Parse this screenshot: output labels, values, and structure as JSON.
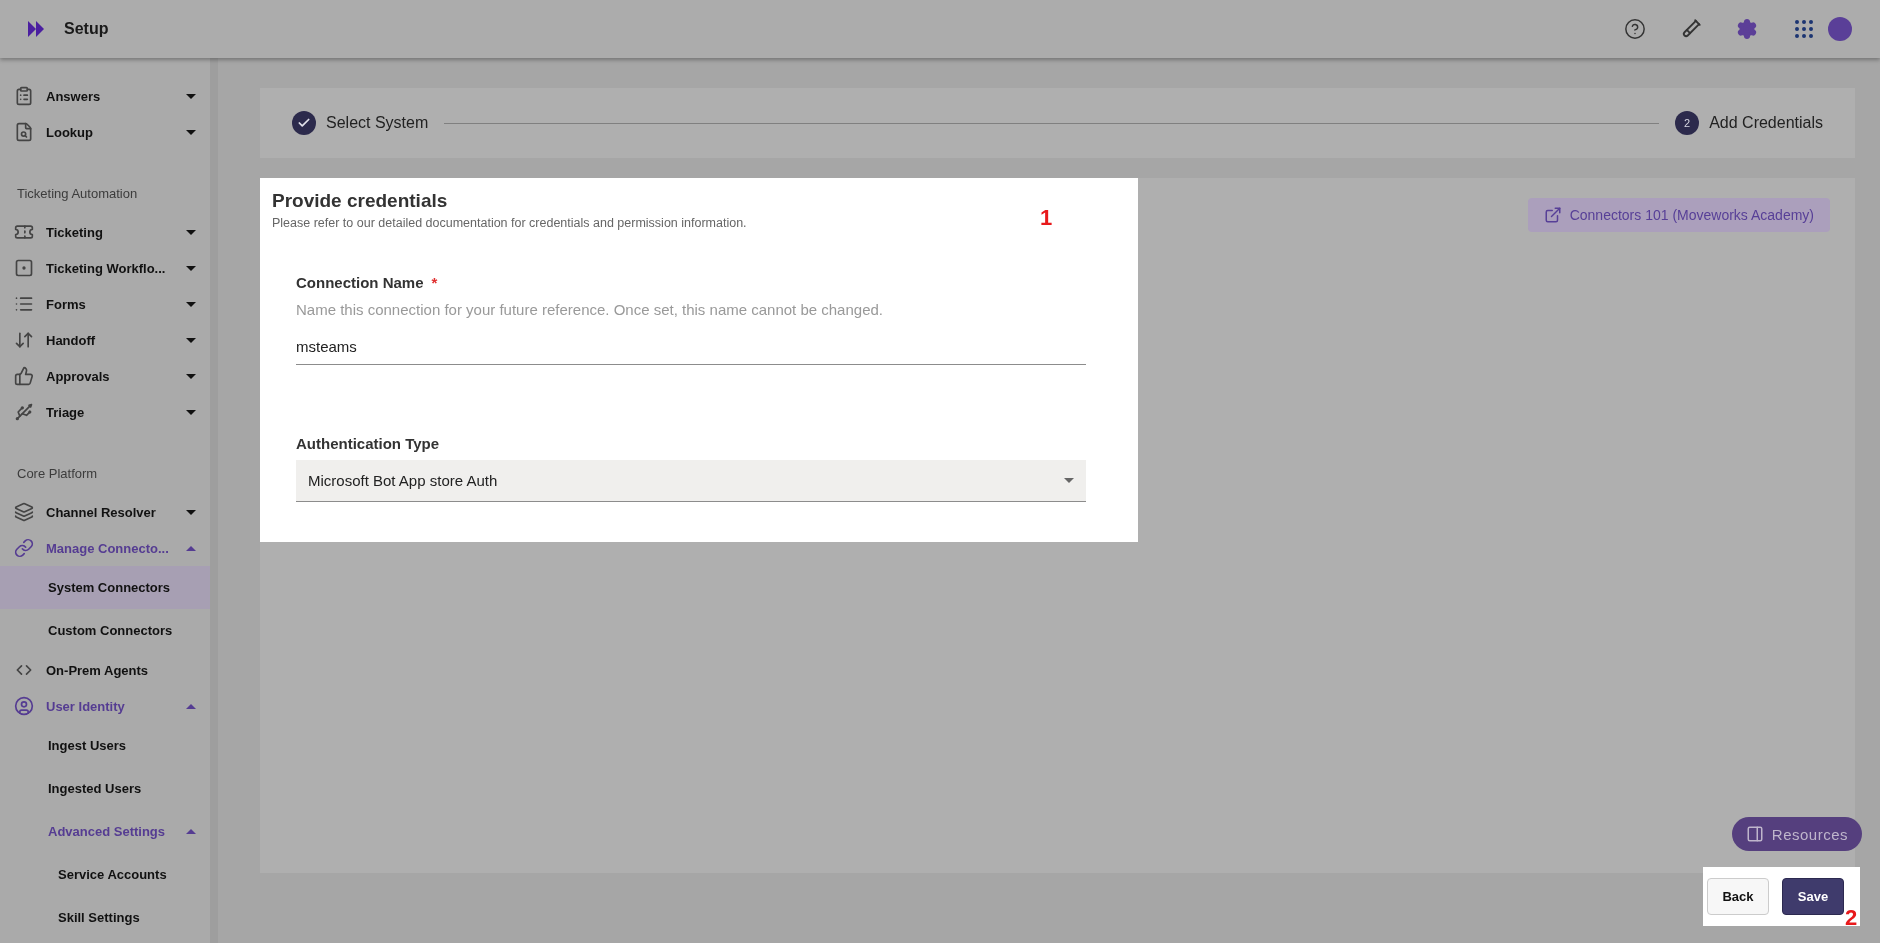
{
  "topbar": {
    "title": "Setup"
  },
  "sidebar": {
    "groups": [
      {
        "items": [
          {
            "kind": "menu",
            "label": "Answers",
            "expanded": false
          },
          {
            "kind": "menu",
            "label": "Lookup",
            "expanded": false
          }
        ]
      },
      {
        "heading": "Ticketing Automation",
        "items": [
          {
            "kind": "menu",
            "label": "Ticketing",
            "expanded": false
          },
          {
            "kind": "menu",
            "label": "Ticketing Workflo...",
            "expanded": false
          },
          {
            "kind": "menu",
            "label": "Forms",
            "expanded": false
          },
          {
            "kind": "menu",
            "label": "Handoff",
            "expanded": false
          },
          {
            "kind": "menu",
            "label": "Approvals",
            "expanded": false
          },
          {
            "kind": "menu",
            "label": "Triage",
            "expanded": false
          }
        ]
      },
      {
        "heading": "Core Platform",
        "items": [
          {
            "kind": "menu",
            "label": "Channel Resolver",
            "expanded": false
          },
          {
            "kind": "menu",
            "label": "Manage Connecto...",
            "expanded": true,
            "children": [
              {
                "label": "System Connectors",
                "selected": true
              },
              {
                "label": "Custom Connectors",
                "selected": false
              }
            ]
          },
          {
            "kind": "link",
            "label": "On-Prem Agents"
          },
          {
            "kind": "menu",
            "label": "User Identity",
            "expanded": true,
            "children": [
              {
                "label": "Ingest Users",
                "selected": false
              },
              {
                "label": "Ingested Users",
                "selected": false
              },
              {
                "label": "Advanced Settings",
                "selected": false,
                "expanded": true,
                "children": [
                  {
                    "label": "Service Accounts",
                    "selected": false
                  },
                  {
                    "label": "Skill Settings",
                    "selected": false
                  }
                ]
              }
            ]
          }
        ]
      }
    ]
  },
  "stepper": {
    "steps": [
      {
        "label": "Select System",
        "completed": true
      },
      {
        "label": "Add Credentials",
        "number": "2",
        "completed": false
      }
    ]
  },
  "form": {
    "title": "Provide credentials",
    "description": "Please refer to our detailed documentation for credentials and permission information.",
    "fields": [
      {
        "kind": "text",
        "label": "Connection Name",
        "required_mark": "*",
        "hint": "Name this connection for your future reference. Once set, this name cannot be changed.",
        "value": "msteams"
      },
      {
        "kind": "select",
        "label": "Authentication Type",
        "value": "Microsoft Bot App store Auth"
      }
    ]
  },
  "academy_link": "Connectors 101 (Moveworks Academy)",
  "resources_button": "Resources",
  "footer": {
    "buttons": [
      {
        "kind": "secondary",
        "label": "Back"
      },
      {
        "kind": "primary",
        "label": "Save"
      }
    ]
  },
  "annotations": [
    "1",
    "2"
  ]
}
